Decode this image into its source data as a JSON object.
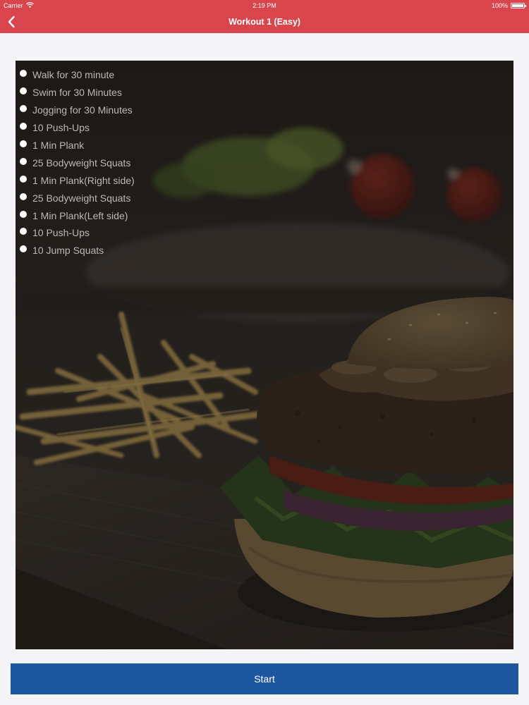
{
  "status_bar": {
    "carrier": "Carrier",
    "time": "2:19 PM",
    "battery": "100%",
    "battery_level": 1.0,
    "wifi_icon": "wifi-icon",
    "battery_icon": "battery-icon"
  },
  "nav": {
    "title": "Workout 1 (Easy)",
    "back_icon": "chevron-left-icon"
  },
  "workout": {
    "background_image": "burger-and-fries-photo",
    "exercises": [
      "Walk for 30 minute",
      "Swim for 30 Minutes",
      "Jogging for 30 Minutes",
      "10 Push-Ups",
      "1 Min Plank",
      "25 Bodyweight Squats",
      "1 Min Plank(Right side)",
      "25 Bodyweight Squats",
      "1 Min Plank(Left side)",
      "10 Push-Ups",
      "10 Jump Squats"
    ]
  },
  "actions": {
    "start_label": "Start"
  },
  "colors": {
    "header": "#d9454d",
    "button": "#1d57a0",
    "page_background": "#f4f4f6"
  }
}
